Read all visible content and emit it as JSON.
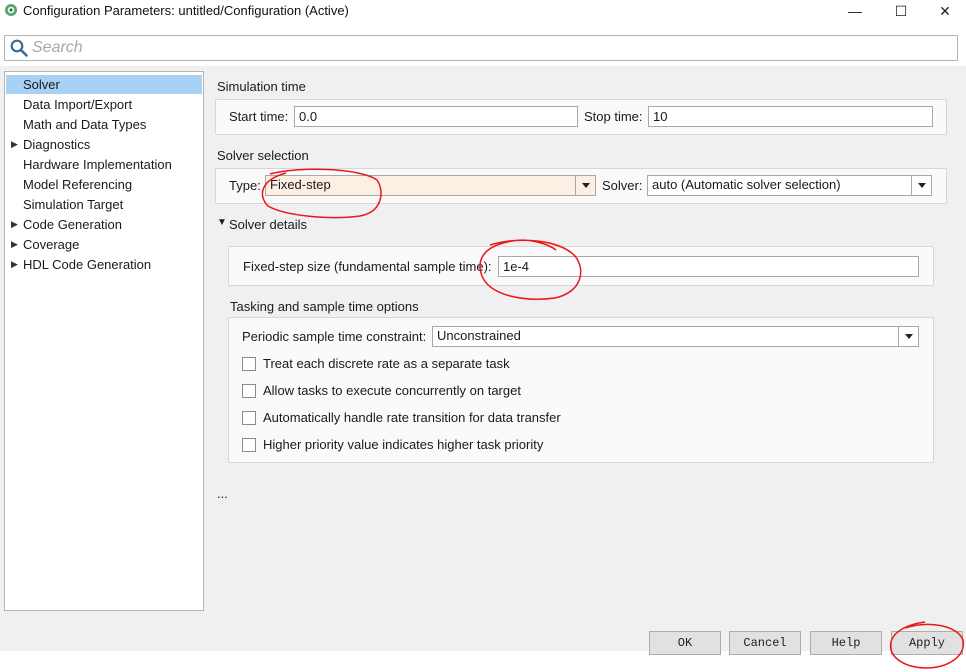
{
  "window": {
    "title": "Configuration Parameters: untitled/Configuration (Active)",
    "controls": {
      "minimize": "—",
      "maximize": "☐",
      "close": "✕"
    }
  },
  "search": {
    "placeholder": "Search",
    "value": ""
  },
  "tree": {
    "items": [
      {
        "label": "Solver",
        "selected": true,
        "expandable": false
      },
      {
        "label": "Data Import/Export",
        "expandable": false
      },
      {
        "label": "Math and Data Types",
        "expandable": false
      },
      {
        "label": "Diagnostics",
        "expandable": true
      },
      {
        "label": "Hardware Implementation",
        "expandable": false
      },
      {
        "label": "Model Referencing",
        "expandable": false
      },
      {
        "label": "Simulation Target",
        "expandable": false
      },
      {
        "label": "Code Generation",
        "expandable": true
      },
      {
        "label": "Coverage",
        "expandable": true
      },
      {
        "label": "HDL Code Generation",
        "expandable": true
      }
    ]
  },
  "simulation_time": {
    "heading": "Simulation time",
    "start_label": "Start time:",
    "start_value": "0.0",
    "stop_label": "Stop time:",
    "stop_value": "10"
  },
  "solver_selection": {
    "heading": "Solver selection",
    "type_label": "Type:",
    "type_value": "Fixed-step",
    "solver_label": "Solver:",
    "solver_value": "auto (Automatic solver selection)"
  },
  "solver_details": {
    "heading": "Solver details",
    "step_label": "Fixed-step size (fundamental sample time):",
    "step_value": "1e-4"
  },
  "tasking": {
    "heading": "Tasking and sample time options",
    "constraint_label": "Periodic sample time constraint:",
    "constraint_value": "Unconstrained",
    "checkboxes": [
      {
        "label": "Treat each discrete rate as a separate task",
        "checked": false
      },
      {
        "label": "Allow tasks to execute concurrently on target",
        "checked": false
      },
      {
        "label": "Automatically handle rate transition for data transfer",
        "checked": false
      },
      {
        "label": "Higher priority value indicates higher task priority",
        "checked": false
      }
    ]
  },
  "ellipsis": "...",
  "buttons": {
    "ok": "OK",
    "cancel": "Cancel",
    "help": "Help",
    "apply": "Apply"
  },
  "colors": {
    "selection": "#a9d1f5",
    "annotation": "#e8171b",
    "type_highlight": "#fcf0e4"
  }
}
